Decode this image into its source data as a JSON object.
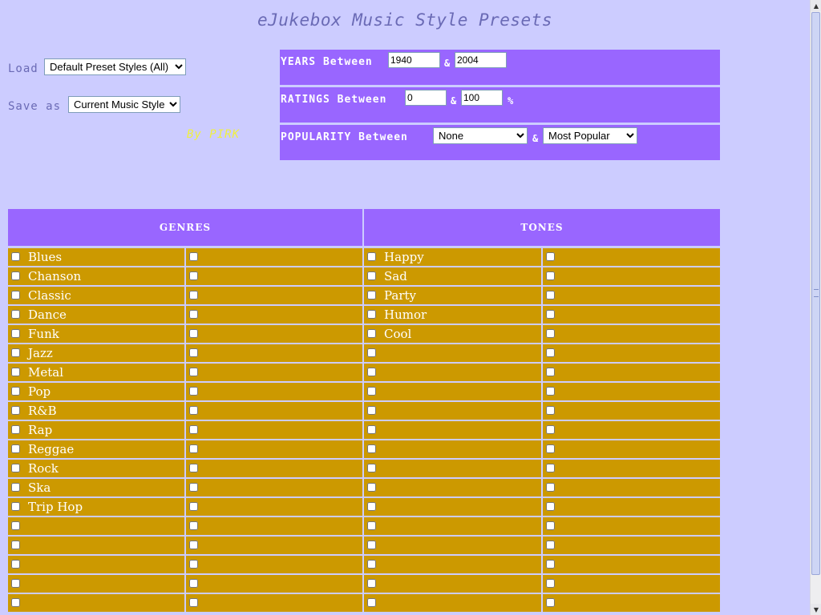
{
  "title": "eJukebox Music Style Presets",
  "load": {
    "label": "Load",
    "value": "Default Preset Styles (All)"
  },
  "save": {
    "label": "Save as",
    "value": "Current Music Style"
  },
  "byline": "By PIRK",
  "filters": {
    "years": {
      "label": "YEARS Between",
      "from": "1940",
      "amp": "&",
      "to": "2004"
    },
    "ratings": {
      "label": "RATINGS Between",
      "from": "0",
      "amp": "&",
      "to": "100",
      "unit": "%"
    },
    "popularity": {
      "label": "POPULARITY Between",
      "from": "None",
      "amp": "&",
      "to": "Most Popular"
    }
  },
  "genres": {
    "header": "GENRES",
    "items": [
      "Blues",
      "Chanson",
      "Classic",
      "Dance",
      "Funk",
      "Jazz",
      "Metal",
      "Pop",
      "R&B",
      "Rap",
      "Reggae",
      "Rock",
      "Ska",
      "Trip Hop",
      "",
      "",
      "",
      "",
      ""
    ]
  },
  "tones": {
    "header": "TONES",
    "items": [
      "Happy",
      "Sad",
      "Party",
      "Humor",
      "Cool",
      "",
      "",
      "",
      "",
      "",
      "",
      "",
      "",
      "",
      "",
      "",
      "",
      "",
      ""
    ]
  },
  "colors": {
    "background": "#ccccff",
    "panel": "#9966ff",
    "cell": "#cc9900",
    "title": "#6a6ab5",
    "byline": "#f0f040"
  }
}
